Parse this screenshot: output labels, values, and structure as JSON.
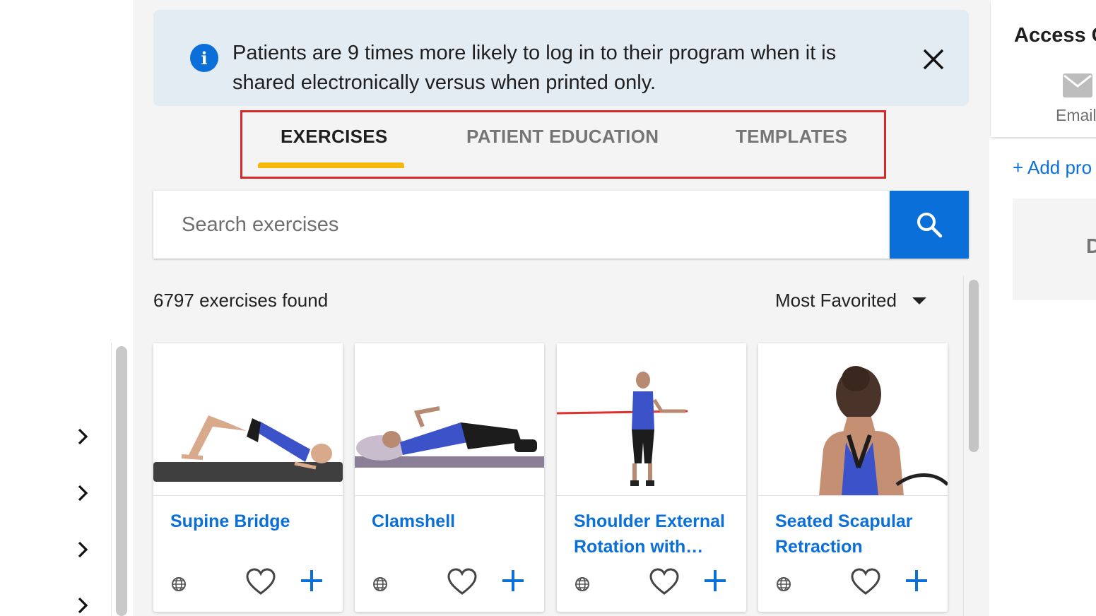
{
  "banner": {
    "text": "Patients are 9 times more likely to log in to their program when it is shared electronically versus when printed only.",
    "icon": "info-icon",
    "close_icon": "close-icon"
  },
  "tabs": [
    {
      "label": "EXERCISES",
      "active": true
    },
    {
      "label": "PATIENT EDUCATION",
      "active": false
    },
    {
      "label": "TEMPLATES",
      "active": false
    }
  ],
  "search": {
    "placeholder": "Search exercises",
    "value": "",
    "button_icon": "search-icon"
  },
  "results": {
    "count_text": "6797 exercises found",
    "sort_label": "Most Favorited"
  },
  "cards": [
    {
      "title": "Supine Bridge"
    },
    {
      "title": "Clamshell"
    },
    {
      "title": "Shoulder External Rotation with…"
    },
    {
      "title": "Seated Scapular Retraction"
    }
  ],
  "right_panel": {
    "title": "Access C",
    "email_label": "Email",
    "add_link": "+ Add pro",
    "box_text": "D"
  },
  "colors": {
    "accent": "#0a6fd8",
    "tab_underline": "#f5b80d",
    "highlight_border": "#d62a2a",
    "banner_bg": "#e3ebf3"
  }
}
